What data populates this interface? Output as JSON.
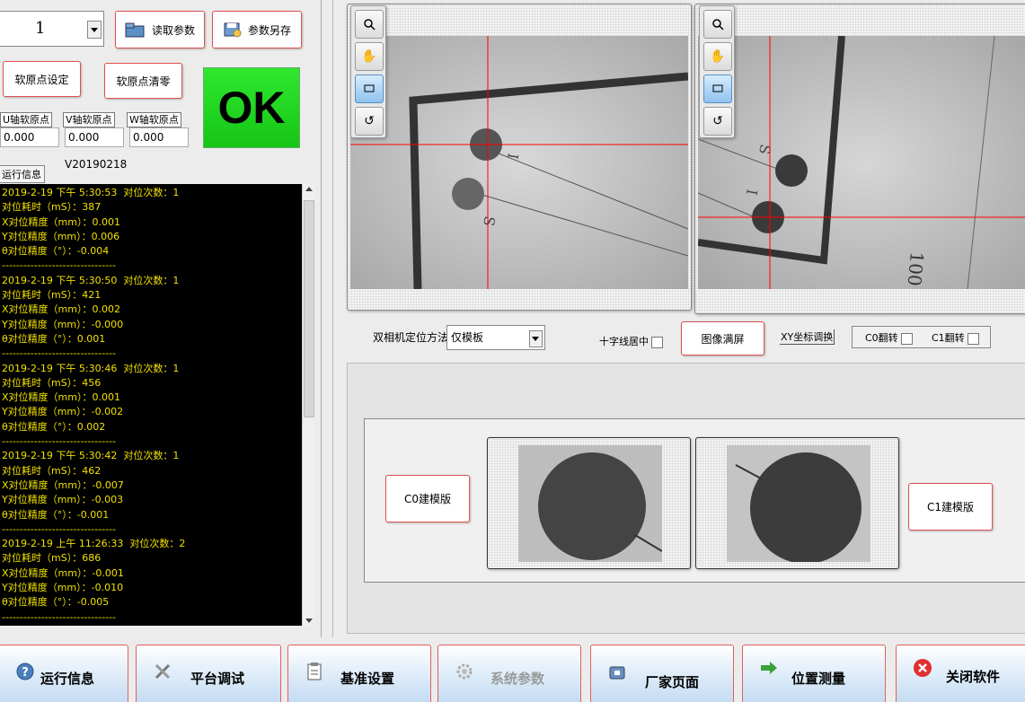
{
  "top": {
    "selector_value": "1",
    "read_params_label": "读取参数",
    "save_params_label": "参数另存"
  },
  "origin": {
    "set_label": "软原点设定",
    "clear_label": "软原点清零",
    "status": "OK",
    "status_color": "#22dd22",
    "u_label": "U轴软原点",
    "v_label": "V轴软原点",
    "w_label": "W轴软原点",
    "u_value": "0.000",
    "v_value": "0.000",
    "w_value": "0.000",
    "version": "V20190218"
  },
  "log": {
    "tab_label": "运行信息",
    "lines": [
      "2019-2-19 下午 5:30:53  对位次数：1",
      "对位耗时（mS）：387",
      "X对位精度（mm）：0.001",
      "Y对位精度（mm）：0.006",
      "θ对位精度（°）：-0.004",
      "--------------------------------",
      "2019-2-19 下午 5:30:50  对位次数：1",
      "对位耗时（mS）：421",
      "X对位精度（mm）：0.002",
      "Y对位精度（mm）：-0.000",
      "θ对位精度（°）：0.001",
      "--------------------------------",
      "2019-2-19 下午 5:30:46  对位次数：1",
      "对位耗时（mS）：456",
      "X对位精度（mm）：0.001",
      "Y对位精度（mm）：-0.002",
      "θ对位精度（°）：0.002",
      "--------------------------------",
      "2019-2-19 下午 5:30:42  对位次数：1",
      "对位耗时（mS）：462",
      "X对位精度（mm）：-0.007",
      "Y对位精度（mm）：-0.003",
      "θ对位精度（°）：-0.001",
      "--------------------------------",
      "2019-2-19 上午 11:26:33  对位次数：2",
      "对位耗时（mS）：686",
      "X对位精度（mm）：-0.001",
      "Y对位精度（mm）：-0.010",
      "θ对位精度（°）：-0.005",
      "--------------------------------"
    ]
  },
  "controls": {
    "method_label": "双相机定位方法",
    "method_value": "仅模板",
    "cross_center_label": "十字线居中",
    "fullscreen_label": "图像满屏",
    "xy_swap_label": "XY坐标调换",
    "c0_flip_label": "C0翻转",
    "c1_flip_label": "C1翻转"
  },
  "templates": {
    "c0_build_label": "C0建模版",
    "c1_build_label": "C1建模版"
  },
  "nav": {
    "items": [
      {
        "label": "运行信息",
        "icon": "help-icon"
      },
      {
        "label": "平台调试",
        "icon": "tools-icon"
      },
      {
        "label": "基准设置",
        "icon": "clipboard-icon"
      },
      {
        "label": "系统参数",
        "icon": "gear-icon"
      },
      {
        "label": "厂家页面",
        "icon": "lock-icon"
      },
      {
        "label": "位置测量",
        "icon": "arrow-icon"
      },
      {
        "label": "关闭软件",
        "icon": "close-icon"
      }
    ]
  },
  "colors": {
    "accent_red": "#e05050",
    "crosshair": "#ff0000",
    "log_text": "#f0e000"
  }
}
